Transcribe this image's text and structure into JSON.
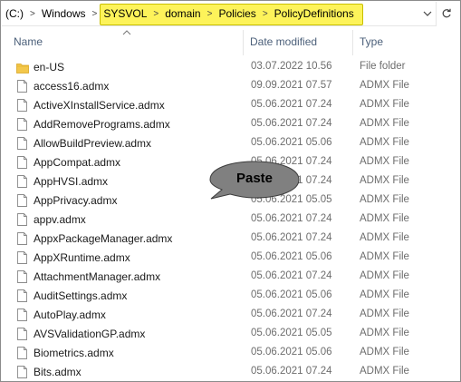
{
  "address_bar": {
    "crumbs": [
      "(C:)",
      "Windows",
      "SYSVOL",
      "domain",
      "Policies",
      "PolicyDefinitions"
    ],
    "dropdown_icon": "chevron-down-icon",
    "refresh_icon": "refresh-icon"
  },
  "columns": {
    "name": "Name",
    "date": "Date modified",
    "type": "Type"
  },
  "files": [
    {
      "name": "en-US",
      "date": "03.07.2022 10.56",
      "type": "File folder",
      "icon": "folder-icon"
    },
    {
      "name": "access16.admx",
      "date": "09.09.2021 07.57",
      "type": "ADMX File",
      "icon": "file-icon"
    },
    {
      "name": "ActiveXInstallService.admx",
      "date": "05.06.2021 07.24",
      "type": "ADMX File",
      "icon": "file-icon"
    },
    {
      "name": "AddRemovePrograms.admx",
      "date": "05.06.2021 07.24",
      "type": "ADMX File",
      "icon": "file-icon"
    },
    {
      "name": "AllowBuildPreview.admx",
      "date": "05.06.2021 05.06",
      "type": "ADMX File",
      "icon": "file-icon"
    },
    {
      "name": "AppCompat.admx",
      "date": "05.06.2021 07.24",
      "type": "ADMX File",
      "icon": "file-icon"
    },
    {
      "name": "AppHVSI.admx",
      "date": "05.06.2021 07.24",
      "type": "ADMX File",
      "icon": "file-icon"
    },
    {
      "name": "AppPrivacy.admx",
      "date": "05.06.2021 05.05",
      "type": "ADMX File",
      "icon": "file-icon"
    },
    {
      "name": "appv.admx",
      "date": "05.06.2021 07.24",
      "type": "ADMX File",
      "icon": "file-icon"
    },
    {
      "name": "AppxPackageManager.admx",
      "date": "05.06.2021 07.24",
      "type": "ADMX File",
      "icon": "file-icon"
    },
    {
      "name": "AppXRuntime.admx",
      "date": "05.06.2021 05.06",
      "type": "ADMX File",
      "icon": "file-icon"
    },
    {
      "name": "AttachmentManager.admx",
      "date": "05.06.2021 07.24",
      "type": "ADMX File",
      "icon": "file-icon"
    },
    {
      "name": "AuditSettings.admx",
      "date": "05.06.2021 05.06",
      "type": "ADMX File",
      "icon": "file-icon"
    },
    {
      "name": "AutoPlay.admx",
      "date": "05.06.2021 07.24",
      "type": "ADMX File",
      "icon": "file-icon"
    },
    {
      "name": "AVSValidationGP.admx",
      "date": "05.06.2021 05.05",
      "type": "ADMX File",
      "icon": "file-icon"
    },
    {
      "name": "Biometrics.admx",
      "date": "05.06.2021 05.06",
      "type": "ADMX File",
      "icon": "file-icon"
    },
    {
      "name": "Bits.admx",
      "date": "05.06.2021 07.24",
      "type": "ADMX File",
      "icon": "file-icon"
    }
  ],
  "callout": {
    "text": "Paste",
    "color": "#808080"
  },
  "colors": {
    "highlight": "#fdf35a",
    "header_text": "#4c607a",
    "folder": "#f3c74b"
  }
}
